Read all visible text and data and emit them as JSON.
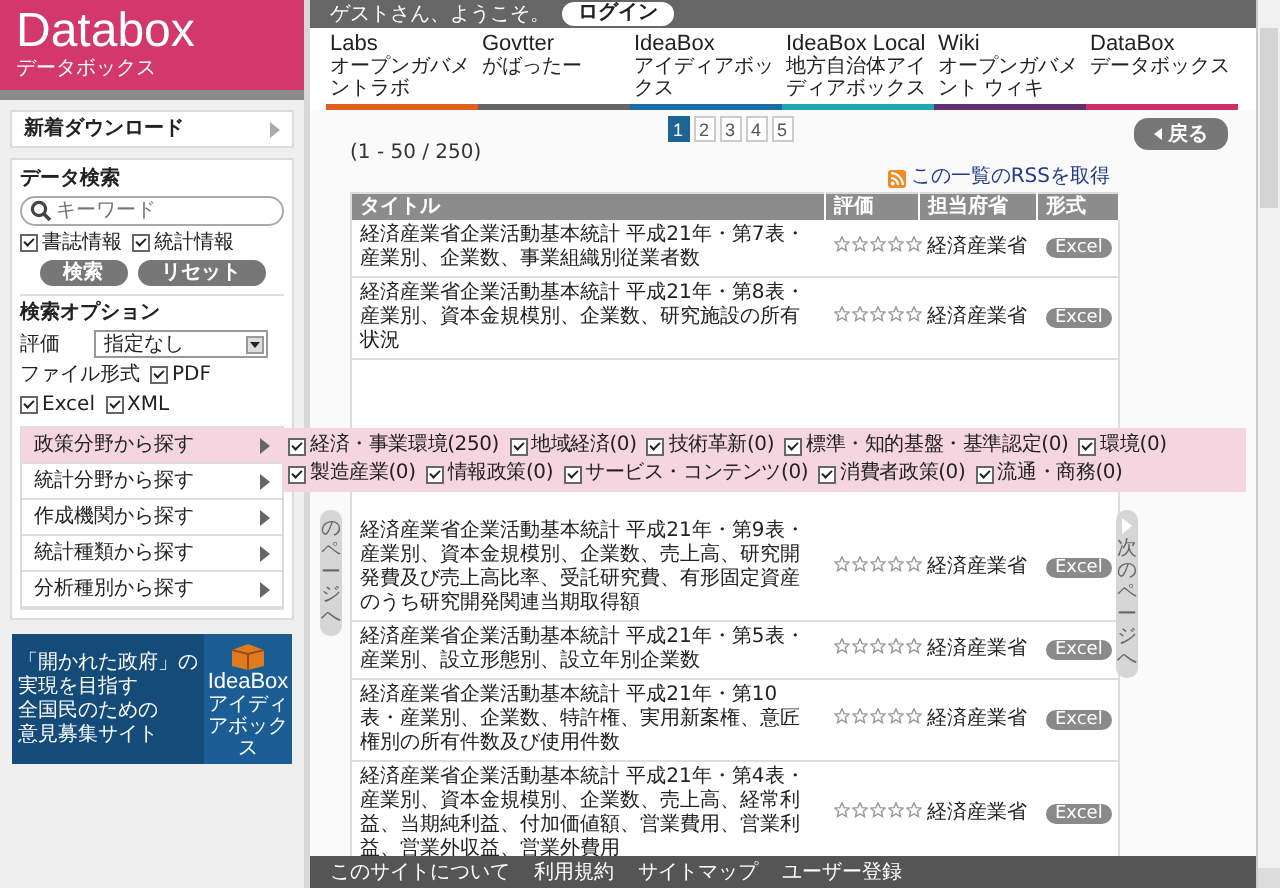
{
  "header": {
    "logo": "Databox",
    "subtitle": "データボックス"
  },
  "top_bar": {
    "greeting": "ゲストさん、ようこそ。",
    "login_button": "ログイン"
  },
  "nav": [
    {
      "label": "Labs",
      "sublabel": "オープンガバメントラボ",
      "color": "#e0601e"
    },
    {
      "label": "Govtter",
      "sublabel": "がばったー",
      "color": "#666666"
    },
    {
      "label": "IdeaBox",
      "sublabel": "アイディアボックス",
      "color": "#1a6ea8"
    },
    {
      "label": "IdeaBox Local",
      "sublabel": "地方自治体アイディアボックス",
      "color": "#20a8b0"
    },
    {
      "label": "Wiki",
      "sublabel": "オープンガバメント ウィキ",
      "color": "#603070"
    },
    {
      "label": "DataBox",
      "sublabel": "データボックス",
      "color": "#d0306a"
    }
  ],
  "sidebar": {
    "new_downloads": "新着ダウンロード",
    "search": {
      "title": "データ検索",
      "placeholder": "キーワード",
      "scopes": [
        {
          "label": "書誌情報",
          "checked": true
        },
        {
          "label": "統計情報",
          "checked": true
        }
      ],
      "buttons": [
        "検索",
        "リセット"
      ],
      "options_title": "検索オプション",
      "rating_label": "評価",
      "rating_value": "指定なし",
      "format_label": "ファイル形式",
      "formats": [
        {
          "label": "PDF",
          "checked": true
        },
        {
          "label": "Excel",
          "checked": true
        },
        {
          "label": "XML",
          "checked": true
        }
      ]
    },
    "browse_menu": [
      {
        "label": "政策分野から探す",
        "selected": true,
        "options": [
          {
            "label": "経済・事業環境(250)",
            "checked": true
          },
          {
            "label": "地域経済(0)",
            "checked": true
          },
          {
            "label": "技術革新(0)",
            "checked": true
          },
          {
            "label": "標準・知的基盤・基準認定(0)",
            "checked": true
          },
          {
            "label": "環境(0)",
            "checked": true
          },
          {
            "label": "製造産業(0)",
            "checked": true
          },
          {
            "label": "情報政策(0)",
            "checked": true
          },
          {
            "label": "サービス・コンテンツ(0)",
            "checked": true
          },
          {
            "label": "消費者政策(0)",
            "checked": true
          },
          {
            "label": "流通・商務(0)",
            "checked": true
          }
        ]
      },
      {
        "label": "統計分野から探す",
        "selected": false
      },
      {
        "label": "作成機関から探す",
        "selected": false
      },
      {
        "label": "統計種類から探す",
        "selected": false
      },
      {
        "label": "分析種別から探す",
        "selected": false
      }
    ],
    "banner": {
      "lines": [
        "「開かれた政府」の",
        "実現を目指す",
        "全国民のための",
        "意見募集サイト"
      ],
      "logo": "IdeaBox",
      "logo_subtitle": "アイディアボックス"
    }
  },
  "content": {
    "back_button": "戻る",
    "pages": [
      {
        "label": "1",
        "selected": true
      },
      {
        "label": "2",
        "selected": false
      },
      {
        "label": "3",
        "selected": false
      },
      {
        "label": "4",
        "selected": false
      },
      {
        "label": "5",
        "selected": false
      }
    ],
    "result_count": "(1 - 50 / 250)",
    "rss_link": "この一覧のRSSを取得",
    "prev_tab": "のページへ",
    "next_tab": "次のページへ"
  },
  "table": {
    "columns": [
      "タイトル",
      "評価",
      "担当府省",
      "形式"
    ],
    "rows": [
      {
        "title": "経済産業省企業活動基本統計 平成21年・第7表・産業別、企業数、事業組織別従業者数",
        "stars": 0,
        "ministry": "経済産業省",
        "format": "Excel"
      },
      {
        "title": "経済産業省企業活動基本統計 平成21年・第8表・産業別、資本金規模別、企業数、研究施設の所有状況",
        "stars": 0,
        "ministry": "経済産業省",
        "format": "Excel"
      },
      {
        "title": "経済産業省企業活動基本統計 平成21年・第9表・産業別、資本金規模別、企業数、売上高、研究開発費及び売上高比率、受託研究費、有形固定資産のうち研究開発関連当期取得額",
        "stars": 0,
        "ministry": "経済産業省",
        "format": "Excel"
      },
      {
        "title": "経済産業省企業活動基本統計 平成21年・第5表・産業別、設立形態別、設立年別企業数",
        "stars": 0,
        "ministry": "経済産業省",
        "format": "Excel"
      },
      {
        "title": "経済産業省企業活動基本統計 平成21年・第10表・産業別、企業数、特許権、実用新案権、意匠権別の所有件数及び使用件数",
        "stars": 0,
        "ministry": "経済産業省",
        "format": "Excel"
      },
      {
        "title": "経済産業省企業活動基本統計 平成21年・第4表・産業別、資本金規模別、企業数、売上高、経常利益、当期純利益、付加価値額、営業費用、営業利益、営業外収益、営業外費用",
        "stars": 0,
        "ministry": "経済産業省",
        "format": "Excel"
      }
    ]
  },
  "footer_links": [
    "このサイトについて",
    "利用規約",
    "サイトマップ",
    "ユーザー登録"
  ]
}
